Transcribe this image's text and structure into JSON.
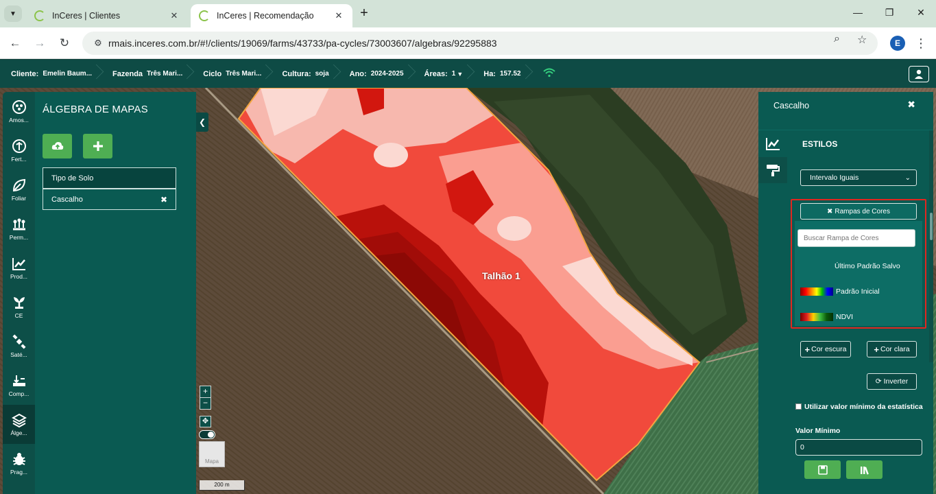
{
  "browser": {
    "tabs": [
      {
        "title": "InCeres | Clientes",
        "active": false
      },
      {
        "title": "InCeres | Recomendação",
        "active": true
      }
    ],
    "url_host": "rmais.inceres.com.br",
    "url_path": "/#!/clients/19069/farms/43733/pa-cycles/73003607/algebras/92295883",
    "profile_initial": "E"
  },
  "header": {
    "cliente_label": "Cliente:",
    "cliente_value": "Emelin Baum...",
    "fazenda_label": "Fazenda",
    "fazenda_value": "Três Mari...",
    "ciclo_label": "Ciclo",
    "ciclo_value": "Três Mari...",
    "cultura_label": "Cultura:",
    "cultura_value": "soja",
    "ano_label": "Ano:",
    "ano_value": "2024-2025",
    "areas_label": "Áreas:",
    "areas_value": "1",
    "ha_label": "Ha:",
    "ha_value": "157.52"
  },
  "rail": [
    {
      "label": "Amos...",
      "icon": "sample-icon"
    },
    {
      "label": "Fert...",
      "icon": "fertility-icon"
    },
    {
      "label": "Foliar",
      "icon": "leaf-icon"
    },
    {
      "label": "Perm...",
      "icon": "plant-row-icon"
    },
    {
      "label": "Prod...",
      "icon": "trend-icon"
    },
    {
      "label": "CE",
      "icon": "sprout-icon"
    },
    {
      "label": "Saté...",
      "icon": "satellite-icon"
    },
    {
      "label": "Comp...",
      "icon": "compaction-icon"
    },
    {
      "label": "Álge...",
      "icon": "layers-icon"
    },
    {
      "label": "Prag...",
      "icon": "bug-icon"
    }
  ],
  "left_panel": {
    "title": "ÁLGEBRA DE MAPAS",
    "layers": [
      "Tipo de Solo",
      "Cascalho"
    ]
  },
  "map": {
    "plot_label": "Talhão 1",
    "zoom_in": "+",
    "zoom_out": "−",
    "basemap_label": "Mapa",
    "scale_label": "200 m"
  },
  "right_panel": {
    "title": "Cascalho",
    "section": "ESTILOS",
    "classification": "Intervalo Iguais",
    "ramp_button": "Rampas de Cores",
    "ramp_search_placeholder": "Buscar Rampa de Cores",
    "ramps": [
      "Último Padrão Salvo",
      "Padrão Inicial",
      "NDVI"
    ],
    "dark_color_button": "Cor escura",
    "light_color_button": "Cor clara",
    "invert_button": "Inverter",
    "use_min_label": "Utilizar valor mínimo da estatística",
    "min_value_label": "Valor Mínimo",
    "min_value": "0"
  },
  "colors": {
    "brand_dark": "#0e4b45",
    "panel": "#0a5a52",
    "action_green": "#4fae53",
    "highlight_red": "#e2261f"
  }
}
